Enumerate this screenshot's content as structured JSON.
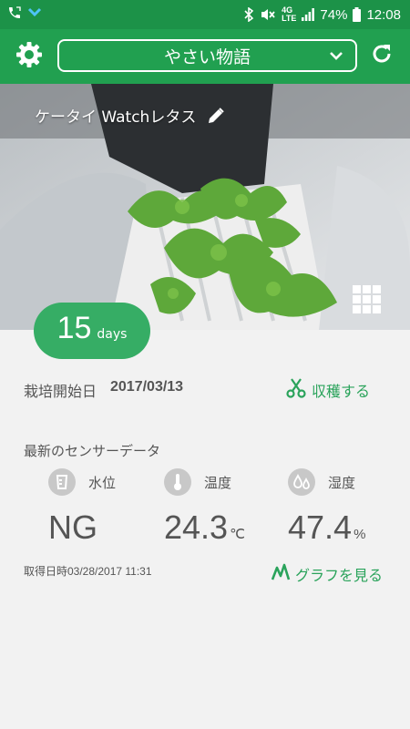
{
  "status_bar": {
    "icons_left": [
      "phone-icon",
      "chevron-icon"
    ],
    "network_top": "4G",
    "network_bottom": "LTE",
    "battery": "74%",
    "time": "12:08"
  },
  "app_bar": {
    "kit_name": "やさい物語",
    "colors": {
      "status": "#1c9248",
      "bar": "#21a050",
      "accent": "#2aa35b"
    }
  },
  "photo": {
    "plant_name": "ケータイ Watchレタス"
  },
  "days": {
    "count": "15",
    "unit": "days"
  },
  "cultivation": {
    "start_label": "栽培開始日",
    "start_date": "2017/03/13",
    "harvest_label": "収穫する"
  },
  "sensors": {
    "heading": "最新のセンサーデータ",
    "items": [
      {
        "icon": "water-level-icon",
        "label": "水位",
        "value": "NG",
        "unit": ""
      },
      {
        "icon": "thermometer-icon",
        "label": "温度",
        "value": "24.3",
        "unit": "℃"
      },
      {
        "icon": "humidity-icon",
        "label": "湿度",
        "value": "47.4",
        "unit": "%"
      }
    ],
    "fetched_at": "取得日時03/28/2017 11:31",
    "graph_label": "グラフを見る"
  }
}
